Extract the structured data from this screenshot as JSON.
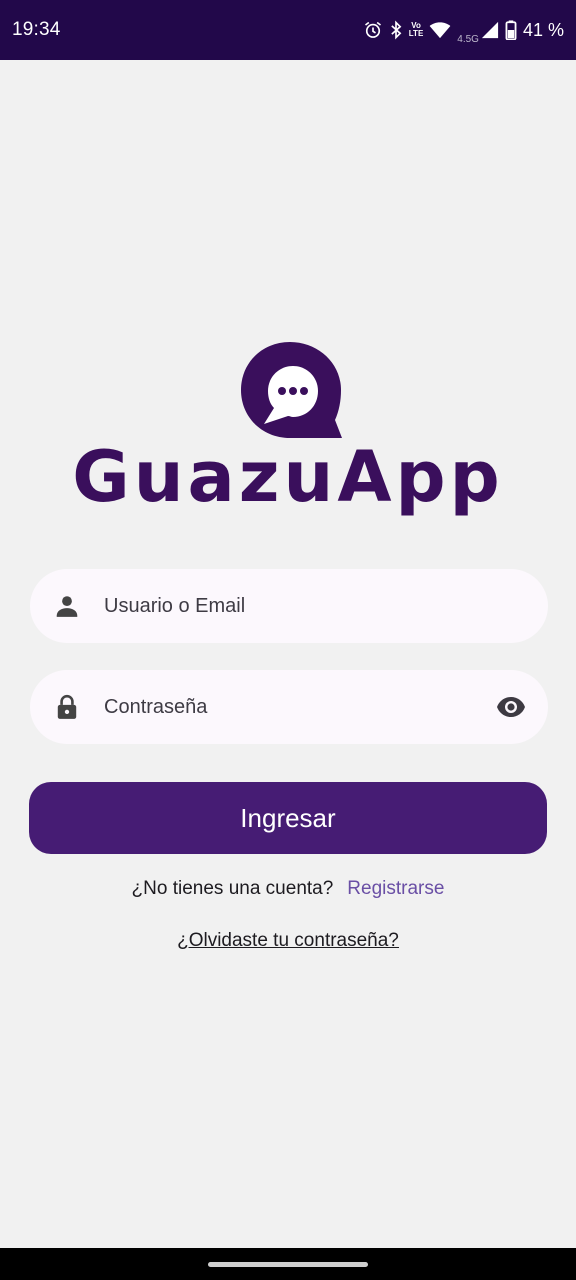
{
  "status_bar": {
    "time": "19:34",
    "network_label": "4.5G",
    "volte_top": "Vo",
    "volte_bottom": "LTE",
    "battery_percent": "41 %",
    "icons": [
      "alarm-icon",
      "bluetooth-icon",
      "volte-icon",
      "wifi-icon",
      "signal-icon",
      "battery-icon"
    ]
  },
  "brand": {
    "name": "GuazuApp",
    "logo_icon": "chat-bubble-icon",
    "color": "#3a0f5c"
  },
  "login_form": {
    "username_placeholder": "Usuario o Email",
    "username_icon": "person-icon",
    "password_placeholder": "Contraseña",
    "password_icon": "lock-icon",
    "password_toggle_icon": "eye-icon",
    "submit_label": "Ingresar",
    "submit_color": "#461c74"
  },
  "register": {
    "question": "¿No tienes una cuenta?",
    "link_label": "Registrarse",
    "link_color": "#6a4fa5"
  },
  "forgot_password": {
    "label": "¿Olvidaste tu contraseña?"
  }
}
